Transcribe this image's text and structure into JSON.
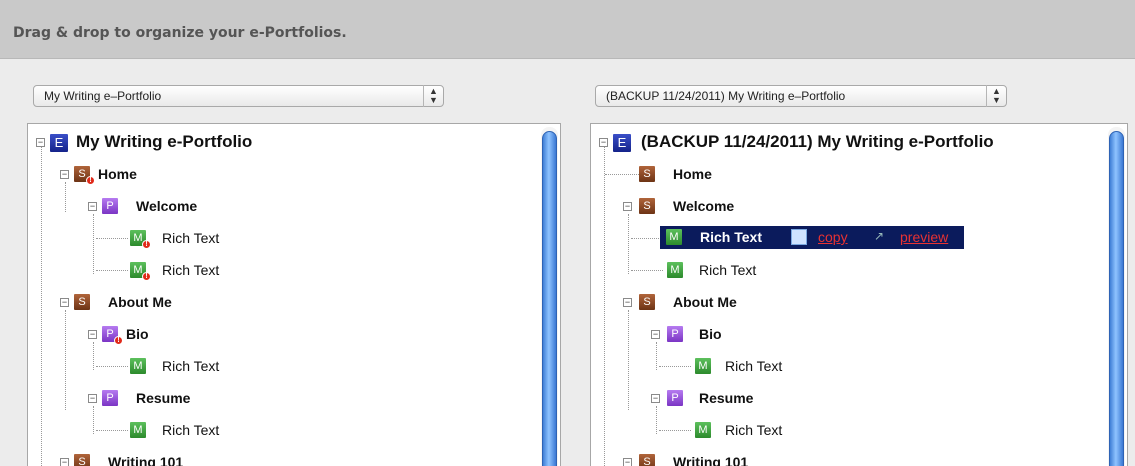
{
  "header": {
    "title": "Drag & drop to organize your e-Portfolios."
  },
  "left": {
    "select_value": "My Writing e–Portfolio",
    "tree": {
      "root": "My Writing e-Portfolio",
      "home": "Home",
      "welcome": "Welcome",
      "rich1": "Rich Text",
      "rich2": "Rich Text",
      "about": "About Me",
      "bio": "Bio",
      "rich3": "Rich Text",
      "resume": "Resume",
      "rich4": "Rich Text",
      "writing": "Writing 101"
    }
  },
  "right": {
    "select_value": "(BACKUP 11/24/2011) My Writing e–Portfolio",
    "tree": {
      "root": "(BACKUP 11/24/2011) My Writing e-Portfolio",
      "home": "Home",
      "welcome": "Welcome",
      "rich1": "Rich Text",
      "copy": "copy",
      "preview": "preview",
      "rich2": "Rich Text",
      "about": "About Me",
      "bio": "Bio",
      "rich3": "Rich Text",
      "resume": "Resume",
      "rich4": "Rich Text",
      "writing": "Writing 101"
    }
  },
  "badges": {
    "e": "E",
    "s": "S",
    "p": "P",
    "m": "M",
    "warn": "!"
  }
}
